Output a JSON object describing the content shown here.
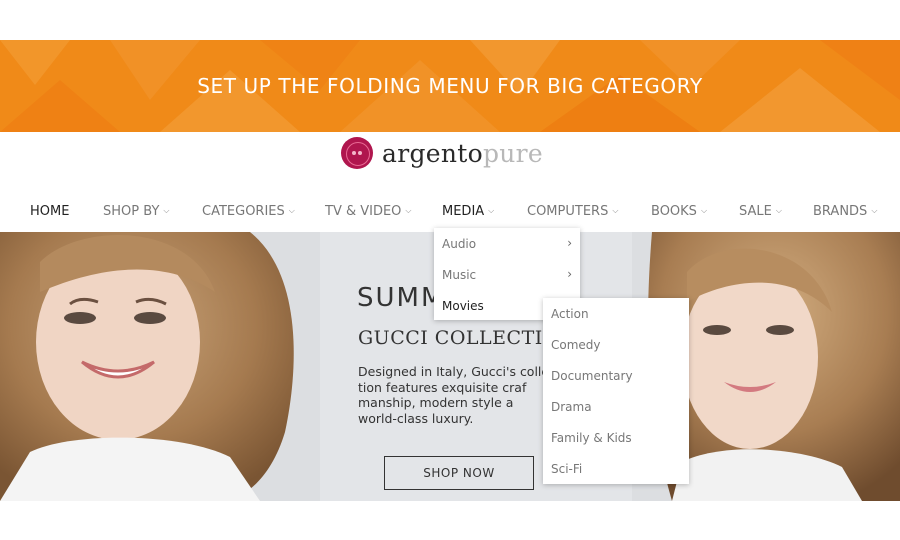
{
  "banner": {
    "text": "SET UP THE FOLDING MENU FOR BIG CATEGORY",
    "color": "#f08a18"
  },
  "logo": {
    "part1": "argento",
    "part2": "pure",
    "mark_color": "#b0164e"
  },
  "nav": {
    "items": [
      {
        "label": "HOME",
        "dropdown": false,
        "active": true
      },
      {
        "label": "SHOP BY",
        "dropdown": true
      },
      {
        "label": "CATEGORIES",
        "dropdown": true
      },
      {
        "label": "TV & VIDEO",
        "dropdown": true
      },
      {
        "label": "MEDIA",
        "dropdown": true,
        "active": true
      },
      {
        "label": "COMPUTERS",
        "dropdown": true
      },
      {
        "label": "BOOKS",
        "dropdown": true
      },
      {
        "label": "SALE",
        "dropdown": true
      },
      {
        "label": "BRANDS",
        "dropdown": true
      }
    ]
  },
  "hero": {
    "title": "SUMM",
    "subtitle": "GUCCI COLLECTIO",
    "body_lines": [
      "Designed in Italy, Gucci's colle",
      "tion features exquisite craf",
      "manship, modern style a",
      "world-class luxury."
    ],
    "button_label": "SHOP NOW"
  },
  "media_menu": {
    "items": [
      {
        "label": "Audio",
        "has_submenu": true
      },
      {
        "label": "Music",
        "has_submenu": true
      },
      {
        "label": "Movies",
        "has_submenu": false,
        "active": true
      }
    ]
  },
  "movies_menu": {
    "items": [
      {
        "label": "Action"
      },
      {
        "label": "Comedy"
      },
      {
        "label": "Documentary"
      },
      {
        "label": "Drama"
      },
      {
        "label": "Family & Kids"
      },
      {
        "label": "Sci-Fi"
      }
    ]
  },
  "icons": {
    "chevron": "chevron-down-icon",
    "arrow": "chevron-right-icon"
  }
}
